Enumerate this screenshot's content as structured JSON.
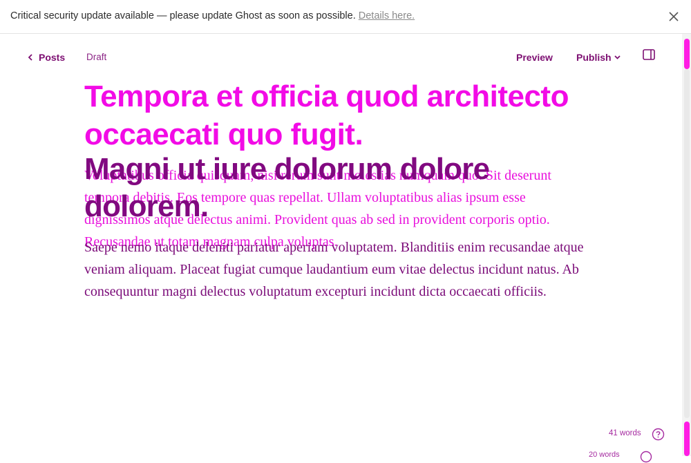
{
  "banner": {
    "message": "Critical security update available — please update Ghost as soon as possible.",
    "link_label": "Details here."
  },
  "header": {
    "back_label": "Posts",
    "status": "Draft",
    "preview_label": "Preview",
    "publish_label": "Publish"
  },
  "editor": {
    "title": "Tempora et officia quod architecto occaecati quo fugit.",
    "title_overlap": "Magni ut iure dolorum dolore dolorem.",
    "paragraph_overlap": "Voluptatibus officia quisquam, nisi rerum sunt molestias numquam quo. Sit deserunt tempora debitis. Eos tempore quas repellat. Ullam voluptatibus alias ipsum esse dignissimos atque delectus animi. Provident quas ab sed in provident corporis optio. Recusandae ut totam magnam culpa voluptas.",
    "paragraph_main": "Saepe nemo itaque deleniti pariatur aperiam voluptatem. Blanditiis enim recusandae atque veniam aliquam. Placeat fugiat cumque laudantium eum vitae delectus incidunt natus. Ab consequuntur magni delectus voluptatum excepturi incidunt dicta occaecati officiis."
  },
  "footer": {
    "word_count": "41 words",
    "extra": "20 words"
  },
  "colors": {
    "accent": "#f20be6",
    "dark_accent": "#7d0f72"
  }
}
